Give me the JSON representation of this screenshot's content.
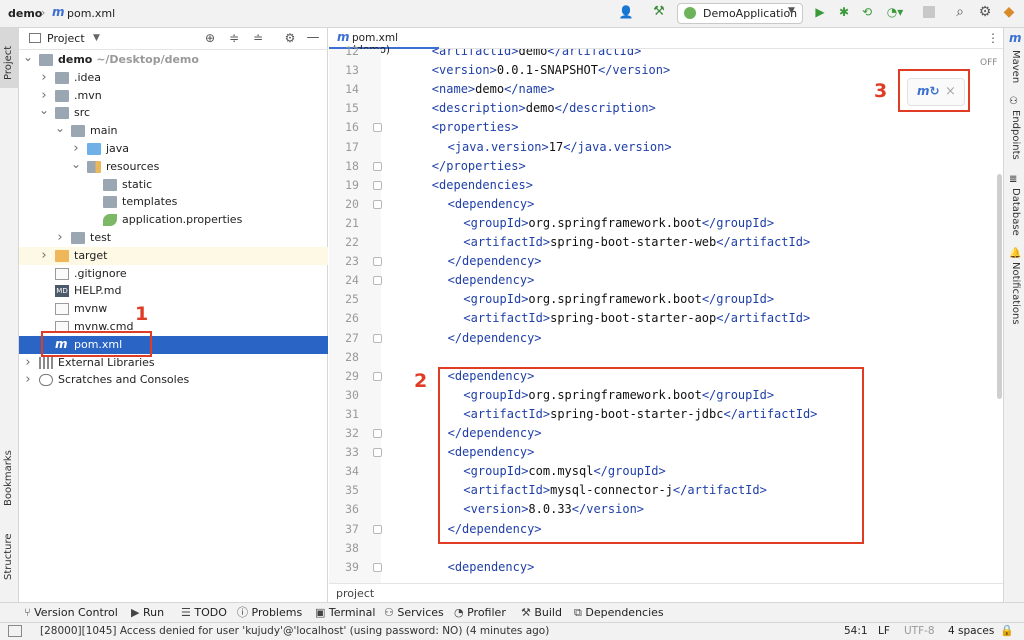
{
  "titlebar": {
    "project": "demo",
    "file": "pom.xml",
    "run_config": "DemoApplication"
  },
  "left_strip": {
    "project": "Project",
    "bookmarks": "Bookmarks",
    "structure": "Structure"
  },
  "right_strip": {
    "maven": "Maven",
    "endpoints": "Endpoints",
    "database": "Database",
    "notifications": "Notifications"
  },
  "project_panel": {
    "title": "Project",
    "tree": [
      {
        "label": "demo",
        "suffix": " ~/Desktop/demo",
        "depth": 0,
        "arrow": "down",
        "icon": "folder",
        "bold": true
      },
      {
        "label": ".idea",
        "depth": 1,
        "arrow": "right",
        "icon": "folder"
      },
      {
        "label": ".mvn",
        "depth": 1,
        "arrow": "right",
        "icon": "folder"
      },
      {
        "label": "src",
        "depth": 1,
        "arrow": "down",
        "icon": "folder"
      },
      {
        "label": "main",
        "depth": 2,
        "arrow": "down",
        "icon": "folder"
      },
      {
        "label": "java",
        "depth": 3,
        "arrow": "right",
        "icon": "folder-blue"
      },
      {
        "label": "resources",
        "depth": 3,
        "arrow": "down",
        "icon": "folder-res"
      },
      {
        "label": "static",
        "depth": 4,
        "arrow": "",
        "icon": "folder"
      },
      {
        "label": "templates",
        "depth": 4,
        "arrow": "",
        "icon": "folder"
      },
      {
        "label": "application.properties",
        "depth": 4,
        "arrow": "",
        "icon": "spring-leaf"
      },
      {
        "label": "test",
        "depth": 2,
        "arrow": "right",
        "icon": "folder"
      },
      {
        "label": "target",
        "depth": 1,
        "arrow": "right",
        "icon": "folder-orange"
      },
      {
        "label": ".gitignore",
        "depth": 1,
        "arrow": "",
        "icon": "file"
      },
      {
        "label": "HELP.md",
        "depth": 1,
        "arrow": "",
        "icon": "md"
      },
      {
        "label": "mvnw",
        "depth": 1,
        "arrow": "",
        "icon": "file"
      },
      {
        "label": "mvnw.cmd",
        "depth": 1,
        "arrow": "",
        "icon": "file"
      },
      {
        "label": "pom.xml",
        "depth": 1,
        "arrow": "",
        "icon": "maven",
        "selected": true
      },
      {
        "label": "External Libraries",
        "depth": 0,
        "arrow": "right",
        "icon": "libs"
      },
      {
        "label": "Scratches and Consoles",
        "depth": 0,
        "arrow": "right",
        "icon": "scratch"
      }
    ]
  },
  "editor": {
    "tab_label": "pom.xml (demo)",
    "off_label": "OFF",
    "breadcrumb": "project",
    "lines": [
      {
        "n": "12",
        "indent": 2,
        "parts": [
          [
            "t",
            "<artifactId>"
          ],
          [
            "x",
            "demo"
          ],
          [
            "t",
            "</artifactId>"
          ]
        ]
      },
      {
        "n": "13",
        "indent": 2,
        "parts": [
          [
            "t",
            "<version>"
          ],
          [
            "x",
            "0.0.1-SNAPSHOT"
          ],
          [
            "t",
            "</version>"
          ]
        ]
      },
      {
        "n": "14",
        "indent": 2,
        "parts": [
          [
            "t",
            "<name>"
          ],
          [
            "x",
            "demo"
          ],
          [
            "t",
            "</name>"
          ]
        ]
      },
      {
        "n": "15",
        "indent": 2,
        "parts": [
          [
            "t",
            "<description>"
          ],
          [
            "x",
            "demo"
          ],
          [
            "t",
            "</description>"
          ]
        ]
      },
      {
        "n": "16",
        "indent": 2,
        "parts": [
          [
            "t",
            "<properties>"
          ]
        ]
      },
      {
        "n": "17",
        "indent": 4,
        "parts": [
          [
            "t",
            "<java.version>"
          ],
          [
            "x",
            "17"
          ],
          [
            "t",
            "</java.version>"
          ]
        ]
      },
      {
        "n": "18",
        "indent": 2,
        "parts": [
          [
            "t",
            "</properties>"
          ]
        ]
      },
      {
        "n": "19",
        "indent": 2,
        "parts": [
          [
            "t",
            "<dependencies>"
          ]
        ]
      },
      {
        "n": "20",
        "indent": 4,
        "parts": [
          [
            "t",
            "<dependency>"
          ]
        ]
      },
      {
        "n": "21",
        "indent": 6,
        "parts": [
          [
            "t",
            "<groupId>"
          ],
          [
            "x",
            "org.springframework.boot"
          ],
          [
            "t",
            "</groupId>"
          ]
        ]
      },
      {
        "n": "22",
        "indent": 6,
        "parts": [
          [
            "t",
            "<artifactId>"
          ],
          [
            "x",
            "spring-boot-starter-web"
          ],
          [
            "t",
            "</artifactId>"
          ]
        ]
      },
      {
        "n": "23",
        "indent": 4,
        "parts": [
          [
            "t",
            "</dependency>"
          ]
        ]
      },
      {
        "n": "24",
        "indent": 4,
        "parts": [
          [
            "t",
            "<dependency>"
          ]
        ]
      },
      {
        "n": "25",
        "indent": 6,
        "parts": [
          [
            "t",
            "<groupId>"
          ],
          [
            "x",
            "org.springframework.boot"
          ],
          [
            "t",
            "</groupId>"
          ]
        ]
      },
      {
        "n": "26",
        "indent": 6,
        "parts": [
          [
            "t",
            "<artifactId>"
          ],
          [
            "x",
            "spring-boot-starter-aop"
          ],
          [
            "t",
            "</artifactId>"
          ]
        ]
      },
      {
        "n": "27",
        "indent": 4,
        "parts": [
          [
            "t",
            "</dependency>"
          ]
        ]
      },
      {
        "n": "28",
        "indent": 0,
        "parts": []
      },
      {
        "n": "29",
        "indent": 4,
        "parts": [
          [
            "t",
            "<dependency>"
          ]
        ]
      },
      {
        "n": "30",
        "indent": 6,
        "parts": [
          [
            "t",
            "<groupId>"
          ],
          [
            "x",
            "org.springframework.boot"
          ],
          [
            "t",
            "</groupId>"
          ]
        ]
      },
      {
        "n": "31",
        "indent": 6,
        "parts": [
          [
            "t",
            "<artifactId>"
          ],
          [
            "x",
            "spring-boot-starter-jdbc"
          ],
          [
            "t",
            "</artifactId>"
          ]
        ]
      },
      {
        "n": "32",
        "indent": 4,
        "parts": [
          [
            "t",
            "</dependency>"
          ]
        ]
      },
      {
        "n": "33",
        "indent": 4,
        "parts": [
          [
            "t",
            "<dependency>"
          ]
        ]
      },
      {
        "n": "34",
        "indent": 6,
        "parts": [
          [
            "t",
            "<groupId>"
          ],
          [
            "x",
            "com.mysql"
          ],
          [
            "t",
            "</groupId>"
          ]
        ]
      },
      {
        "n": "35",
        "indent": 6,
        "parts": [
          [
            "t",
            "<artifactId>"
          ],
          [
            "x",
            "mysql-connector-j"
          ],
          [
            "t",
            "</artifactId>"
          ]
        ]
      },
      {
        "n": "36",
        "indent": 6,
        "parts": [
          [
            "t",
            "<version>"
          ],
          [
            "x",
            "8.0.33"
          ],
          [
            "t",
            "</version>"
          ]
        ]
      },
      {
        "n": "37",
        "indent": 4,
        "parts": [
          [
            "t",
            "</dependency>"
          ]
        ]
      },
      {
        "n": "38",
        "indent": 0,
        "parts": []
      },
      {
        "n": "39",
        "indent": 4,
        "parts": [
          [
            "t",
            "<dependency>"
          ]
        ]
      }
    ]
  },
  "annotations": {
    "one": "1",
    "two": "2",
    "three": "3"
  },
  "bottom_tabs": [
    "Version Control",
    "Run",
    "TODO",
    "Problems",
    "Terminal",
    "Services",
    "Profiler",
    "Build",
    "Dependencies"
  ],
  "status": {
    "message": "[28000][1045] Access denied for user 'kujudy'@'localhost' (using password: NO) (4 minutes ago)",
    "position": "54:1",
    "line_sep": "LF",
    "encoding": "UTF-8",
    "indent": "4 spaces"
  },
  "colors": {
    "tag": "#1f3fa8",
    "selection": "#2a64c5",
    "annotation": "#e03b24",
    "maven_icon": "#3b6fd1"
  }
}
